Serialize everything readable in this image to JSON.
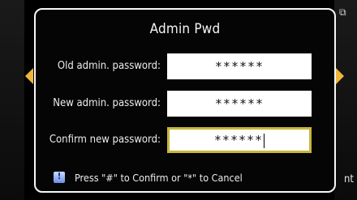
{
  "dialog": {
    "title": "Admin Pwd",
    "fields": [
      {
        "label": "Old admin. password:",
        "value": "******"
      },
      {
        "label": "New admin. password:",
        "value": "******"
      },
      {
        "label": "Confirm new password:",
        "value": "******"
      }
    ],
    "hint": "Press \"#\" to Confirm or \"*\" to Cancel"
  },
  "background": {
    "right_text": "nt"
  },
  "colors": {
    "accent": "#f0b63a",
    "focus_border": "#c9b63a",
    "dialog_border": "#f7f7f7"
  }
}
